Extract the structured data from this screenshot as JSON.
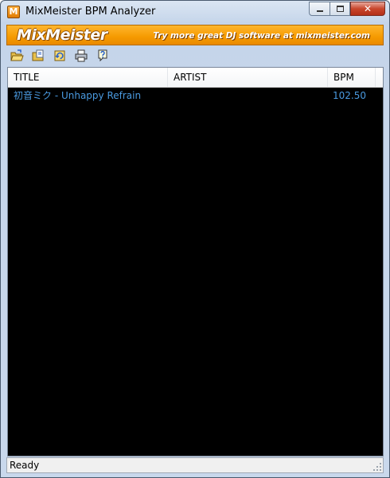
{
  "window": {
    "title": "MixMeister BPM Analyzer",
    "app_icon_letter": "M",
    "close_glyph": "✕"
  },
  "banner": {
    "logo": "MixMeister",
    "slogan": "Try more great DJ software at mixmeister.com",
    "color": "#f59a00"
  },
  "toolbar": {
    "buttons": [
      "open-folder-icon",
      "add-files-icon",
      "refresh-icon",
      "print-icon",
      "help-icon"
    ]
  },
  "list": {
    "columns": [
      "TITLE",
      "ARTIST",
      "BPM"
    ],
    "rows": [
      {
        "title": "初音ミク - Unhappy Refrain",
        "artist": "",
        "bpm": "102.50"
      }
    ],
    "text_color": "#4a9ae0",
    "background": "#000000"
  },
  "status": {
    "text": "Ready"
  }
}
